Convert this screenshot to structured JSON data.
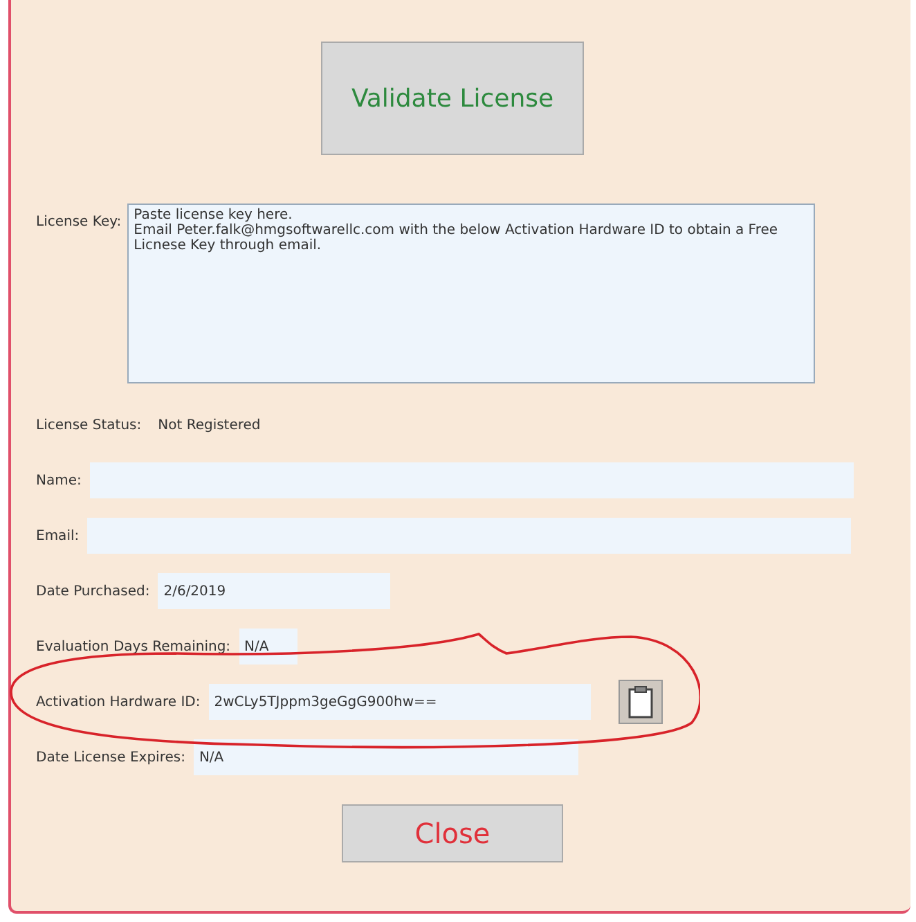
{
  "validate_button": "Validate License",
  "license_key": {
    "label": "License Key:",
    "value": "Paste license key here.\nEmail Peter.falk@hmgsoftwarellc.com with the below Activation Hardware ID to obtain a Free Licnese Key through email."
  },
  "license_status": {
    "label": "License Status:",
    "value": "Not Registered"
  },
  "fields": [
    {
      "kind": "wide",
      "label": "Name:"
    },
    {
      "kind": "wide",
      "label": "Email:"
    },
    {
      "kind": "short",
      "label": "Date Purchased:",
      "value": "2/6/2019"
    },
    {
      "kind": "tiny",
      "label": "Evaluation Days Remaining:",
      "value": "N/A"
    },
    {
      "kind": "copy",
      "label": "Activation Hardware ID:",
      "value": "2wCLy5TJppm3geGgG900hw=="
    },
    {
      "kind": "medium",
      "label": "Date License Expires:",
      "value": "N/A"
    }
  ],
  "close_button": "Close"
}
